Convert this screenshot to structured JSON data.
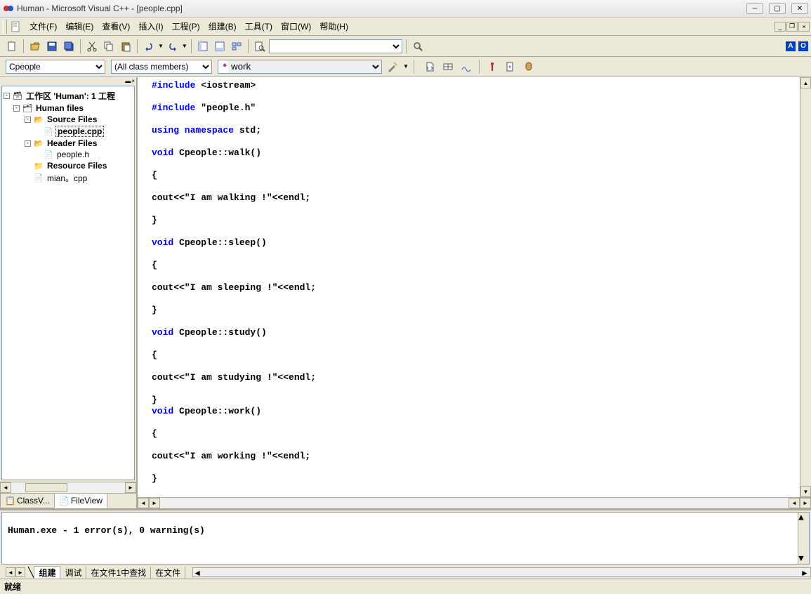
{
  "title": "Human - Microsoft Visual C++ - [people.cpp]",
  "menu": {
    "file": "文件(F)",
    "edit": "编辑(E)",
    "view": "查看(V)",
    "insert": "插入(I)",
    "project": "工程(P)",
    "build": "组建(B)",
    "tools": "工具(T)",
    "window": "窗口(W)",
    "help": "帮助(H)"
  },
  "combos": {
    "class": "Cpeople",
    "members": "(All class members)",
    "func": "work"
  },
  "badges": {
    "a": "A",
    "o": "O"
  },
  "tree": {
    "root": "工作区 'Human': 1 工程",
    "project": "Human files",
    "src_folder": "Source Files",
    "src_file": "people.cpp",
    "hdr_folder": "Header Files",
    "hdr_file": "people.h",
    "res_folder": "Resource Files",
    "main_file": "mian。cpp"
  },
  "side_tabs": {
    "classv": "ClassV...",
    "filev": "FileView"
  },
  "code": {
    "lines": [
      {
        "t": "kw",
        "s": "#include "
      },
      {
        "t": "",
        "s": "<iostream>"
      },
      {
        "br": 1
      },
      {
        "br": 1
      },
      {
        "t": "kw",
        "s": "#include "
      },
      {
        "t": "",
        "s": "\"people.h\""
      },
      {
        "br": 1
      },
      {
        "br": 1
      },
      {
        "t": "kw",
        "s": "using namespace"
      },
      {
        "t": "",
        "s": " std;"
      },
      {
        "br": 1
      },
      {
        "br": 1
      },
      {
        "t": "kw",
        "s": "void"
      },
      {
        "t": "",
        "s": " Cpeople::walk()"
      },
      {
        "br": 1
      },
      {
        "br": 1
      },
      {
        "t": "",
        "s": "{"
      },
      {
        "br": 1
      },
      {
        "br": 1
      },
      {
        "t": "",
        "s": "cout<<\"I am walking !\"<<endl;"
      },
      {
        "br": 1
      },
      {
        "br": 1
      },
      {
        "t": "",
        "s": "}"
      },
      {
        "br": 1
      },
      {
        "br": 1
      },
      {
        "t": "kw",
        "s": "void"
      },
      {
        "t": "",
        "s": " Cpeople::sleep()"
      },
      {
        "br": 1
      },
      {
        "br": 1
      },
      {
        "t": "",
        "s": "{"
      },
      {
        "br": 1
      },
      {
        "br": 1
      },
      {
        "t": "",
        "s": "cout<<\"I am sleeping !\"<<endl;"
      },
      {
        "br": 1
      },
      {
        "br": 1
      },
      {
        "t": "",
        "s": "}"
      },
      {
        "br": 1
      },
      {
        "br": 1
      },
      {
        "t": "kw",
        "s": "void"
      },
      {
        "t": "",
        "s": " Cpeople::study()"
      },
      {
        "br": 1
      },
      {
        "br": 1
      },
      {
        "t": "",
        "s": "{"
      },
      {
        "br": 1
      },
      {
        "br": 1
      },
      {
        "t": "",
        "s": "cout<<\"I am studying !\"<<endl;"
      },
      {
        "br": 1
      },
      {
        "br": 1
      },
      {
        "t": "",
        "s": "}"
      },
      {
        "br": 1
      },
      {
        "t": "kw",
        "s": "void"
      },
      {
        "t": "",
        "s": " Cpeople::work()"
      },
      {
        "br": 1
      },
      {
        "br": 1
      },
      {
        "t": "",
        "s": "{"
      },
      {
        "br": 1
      },
      {
        "br": 1
      },
      {
        "t": "",
        "s": "cout<<\"I am working !\"<<endl;"
      },
      {
        "br": 1
      },
      {
        "br": 1
      },
      {
        "t": "",
        "s": "}"
      },
      {
        "br": 1
      }
    ]
  },
  "output": {
    "line1": "Human.exe - 1 error(s), 0 warning(s)"
  },
  "output_tabs": {
    "build": "组建",
    "debug": "调试",
    "find1": "在文件1中查找",
    "find2": "在文件"
  },
  "status": "就绪"
}
